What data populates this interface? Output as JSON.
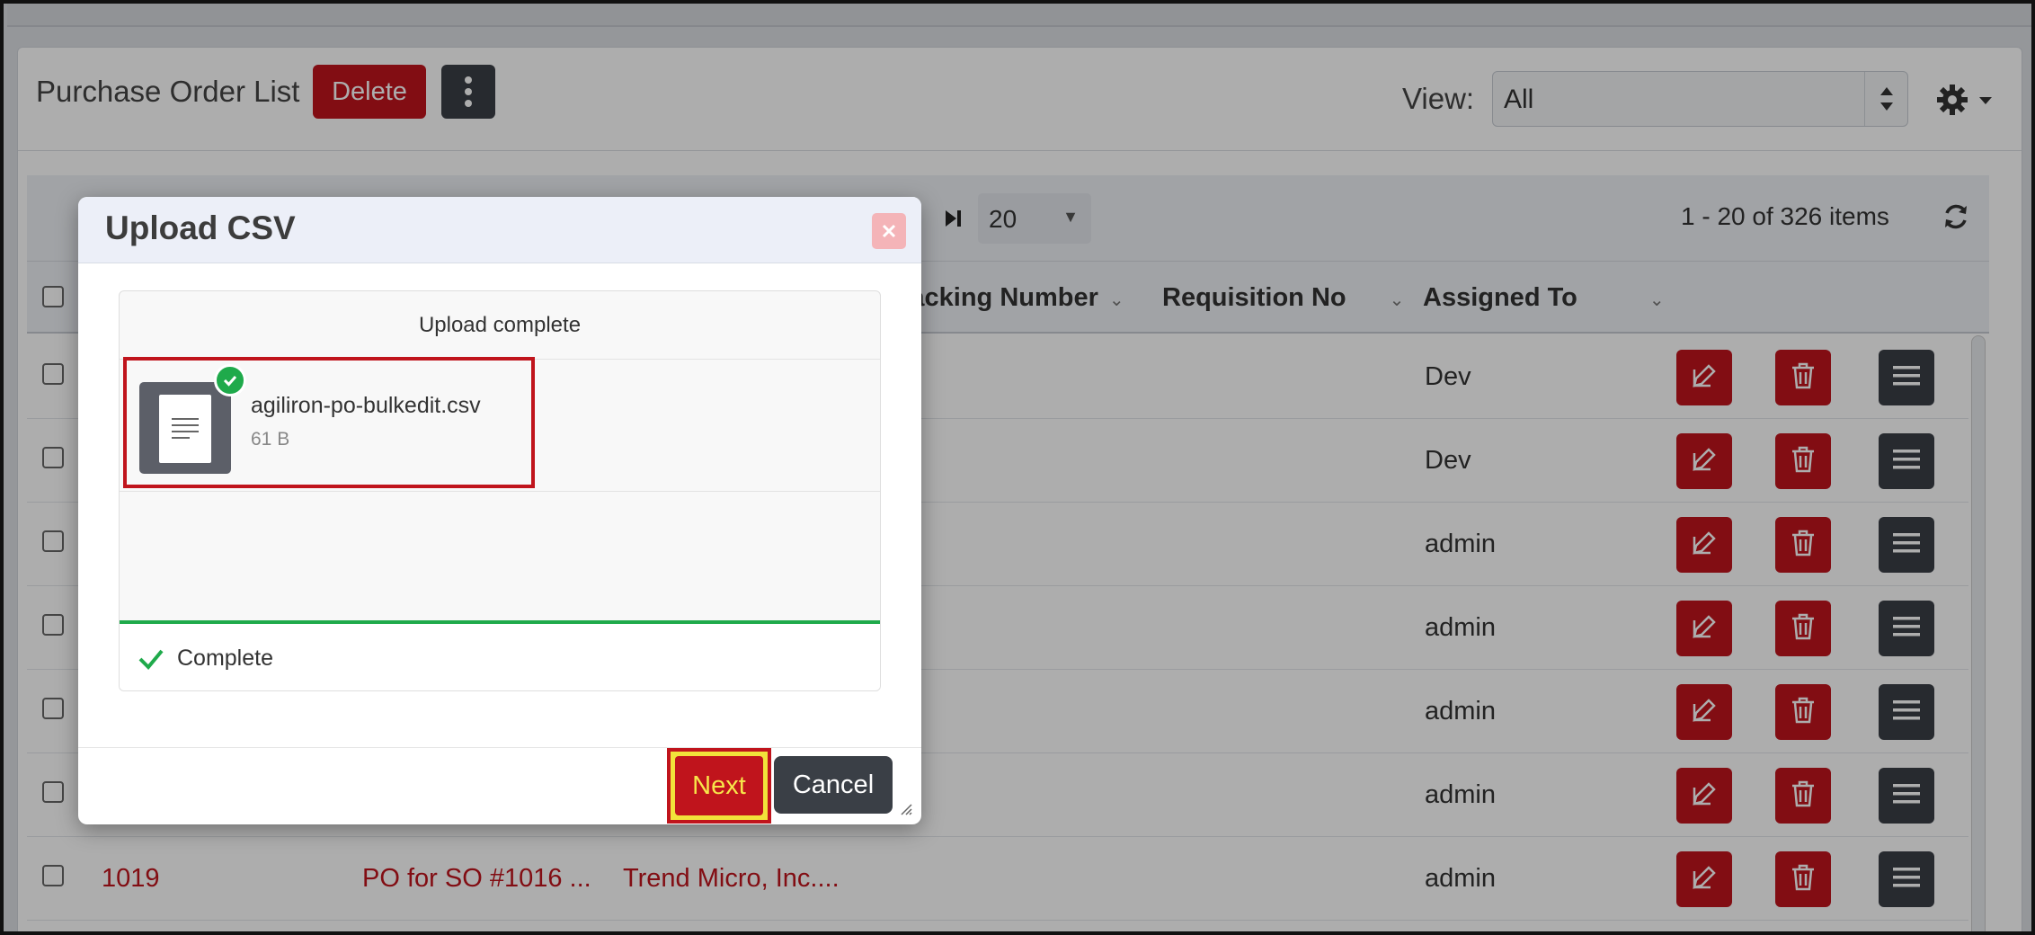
{
  "page": {
    "title": "Purchase Order List",
    "delete_label": "Delete",
    "view_label": "View:",
    "view_value": "All"
  },
  "pager": {
    "page_size": "20",
    "info": "1 - 20 of 326 items"
  },
  "columns": [
    {
      "label": "Tracking Number"
    },
    {
      "label": "Requisition No"
    },
    {
      "label": "Assigned To"
    }
  ],
  "rows": [
    {
      "assigned": "Dev"
    },
    {
      "assigned": "Dev"
    },
    {
      "assigned": "admin"
    },
    {
      "assigned": "admin"
    },
    {
      "assigned": "admin"
    },
    {
      "assigned": "admin"
    },
    {
      "id": "1019",
      "name": "PO for SO #1016 ...",
      "vendor": "Trend Micro, Inc....",
      "assigned": "admin"
    }
  ],
  "modal": {
    "title": "Upload CSV",
    "status": "Upload complete",
    "file_name": "agiliron-po-bulkedit.csv",
    "file_size": "61 B",
    "progress_label": "Complete",
    "progress_percent": 100,
    "next_label": "Next",
    "cancel_label": "Cancel"
  },
  "colors": {
    "brand_red": "#c0141c",
    "dark_button": "#3a3f46",
    "success_green": "#1faa4b",
    "highlight_yellow": "#f2e23a"
  }
}
